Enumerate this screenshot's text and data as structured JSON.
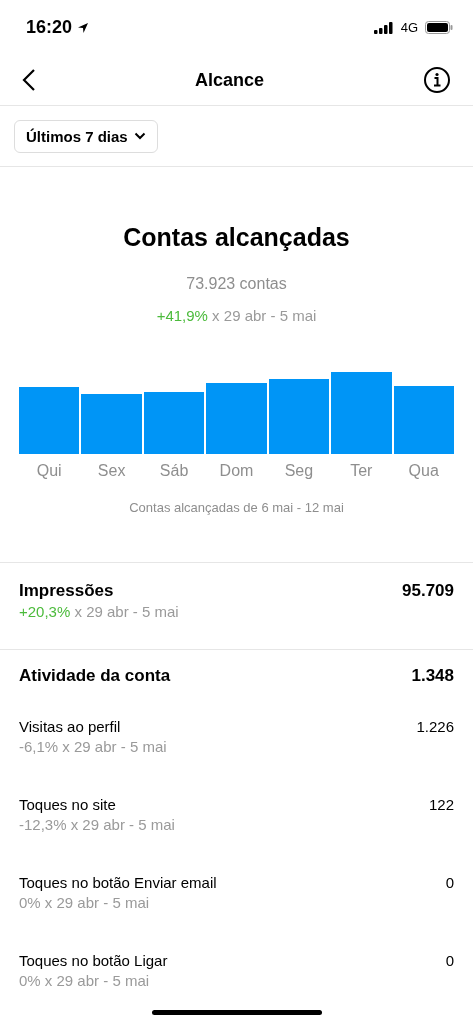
{
  "status_bar": {
    "time": "16:20",
    "network": "4G"
  },
  "nav": {
    "title": "Alcance"
  },
  "filter": {
    "label": "Últimos 7 dias"
  },
  "reach": {
    "title": "Contas alcançadas",
    "count": "73.923 contas",
    "change": {
      "value": "+41,9%",
      "color": "#4cbb3c",
      "period": "x 29 abr - 5 mai"
    },
    "days": [
      "Qui",
      "Sex",
      "Sáb",
      "Dom",
      "Seg",
      "Ter",
      "Qua"
    ],
    "caption": "Contas alcançadas de 6 mai - 12 mai"
  },
  "impressions": {
    "label": "Impressões",
    "value": "95.709",
    "change": {
      "value": "+20,3%",
      "color": "#4cbb3c",
      "period": "x 29 abr - 5 mai"
    }
  },
  "activity": {
    "label": "Atividade da conta",
    "value": "1.348",
    "rows": [
      {
        "label": "Visitas ao perfil",
        "value": "1.226",
        "change": {
          "value": "-6,1%",
          "color": "#9a9a9a",
          "period": "x 29 abr - 5 mai"
        }
      },
      {
        "label": "Toques no site",
        "value": "122",
        "change": {
          "value": "-12,3%",
          "color": "#9a9a9a",
          "period": "x 29 abr - 5 mai"
        }
      },
      {
        "label": "Toques no botão Enviar email",
        "value": "0",
        "change": {
          "value": "0%",
          "color": "#9a9a9a",
          "period": "x 29 abr - 5 mai"
        }
      },
      {
        "label": "Toques no botão Ligar",
        "value": "0",
        "change": {
          "value": "0%",
          "color": "#9a9a9a",
          "period": "x 29 abr - 5 mai"
        }
      }
    ]
  }
}
